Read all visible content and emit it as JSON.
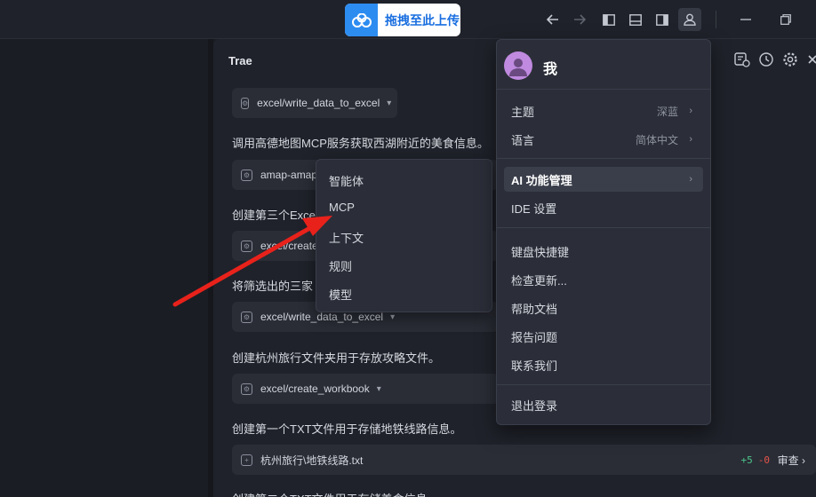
{
  "titlebar": {
    "upload_label": "拖拽至此上传",
    "icons": [
      "back-icon",
      "forward-icon",
      "left-panel-icon",
      "bottom-panel-icon",
      "right-panel-icon",
      "account-icon",
      "minimize-icon",
      "restore-icon"
    ]
  },
  "chat": {
    "title": "Trae",
    "tool_icons": [
      "new-chat-icon",
      "history-icon",
      "settings-icon",
      "close-icon"
    ],
    "chips": [
      {
        "label": "excel/write_data_to_excel"
      },
      {
        "label": "amap-amap"
      },
      {
        "label": "excel/create"
      },
      {
        "label": "excel/write_data_to_excel"
      },
      {
        "label": "excel/create_workbook"
      },
      {
        "label": "杭州旅行\\地铁线路.txt",
        "added": "+5",
        "removed": "-0",
        "review": "审查"
      }
    ],
    "texts": [
      "调用高德地图MCP服务获取西湖附近的美食信息。",
      "创建第三个Excel",
      "将筛选出的三家",
      "创建杭州旅行文件夹用于存放攻略文件。",
      "创建第一个TXT文件用于存储地铁线路信息。",
      "创建第二个TXT文件用于存储美食信息。"
    ]
  },
  "submenu": {
    "items": [
      "智能体",
      "MCP",
      "上下文",
      "规则",
      "模型"
    ]
  },
  "user_menu": {
    "name": "我",
    "items": [
      {
        "label": "主题",
        "value": "深蓝"
      },
      {
        "label": "语言",
        "value": "简体中文"
      },
      {
        "label": "AI 功能管理"
      },
      {
        "label": "IDE 设置"
      },
      {
        "label": "键盘快捷键"
      },
      {
        "label": "检查更新..."
      },
      {
        "label": "帮助文档"
      },
      {
        "label": "报告问题"
      },
      {
        "label": "联系我们"
      },
      {
        "label": "退出登录"
      }
    ]
  },
  "colors": {
    "accent_blue": "#2d8cf0",
    "annotation_red": "#e8221b",
    "diff_add": "#4cc38a",
    "diff_del": "#e5534b"
  }
}
